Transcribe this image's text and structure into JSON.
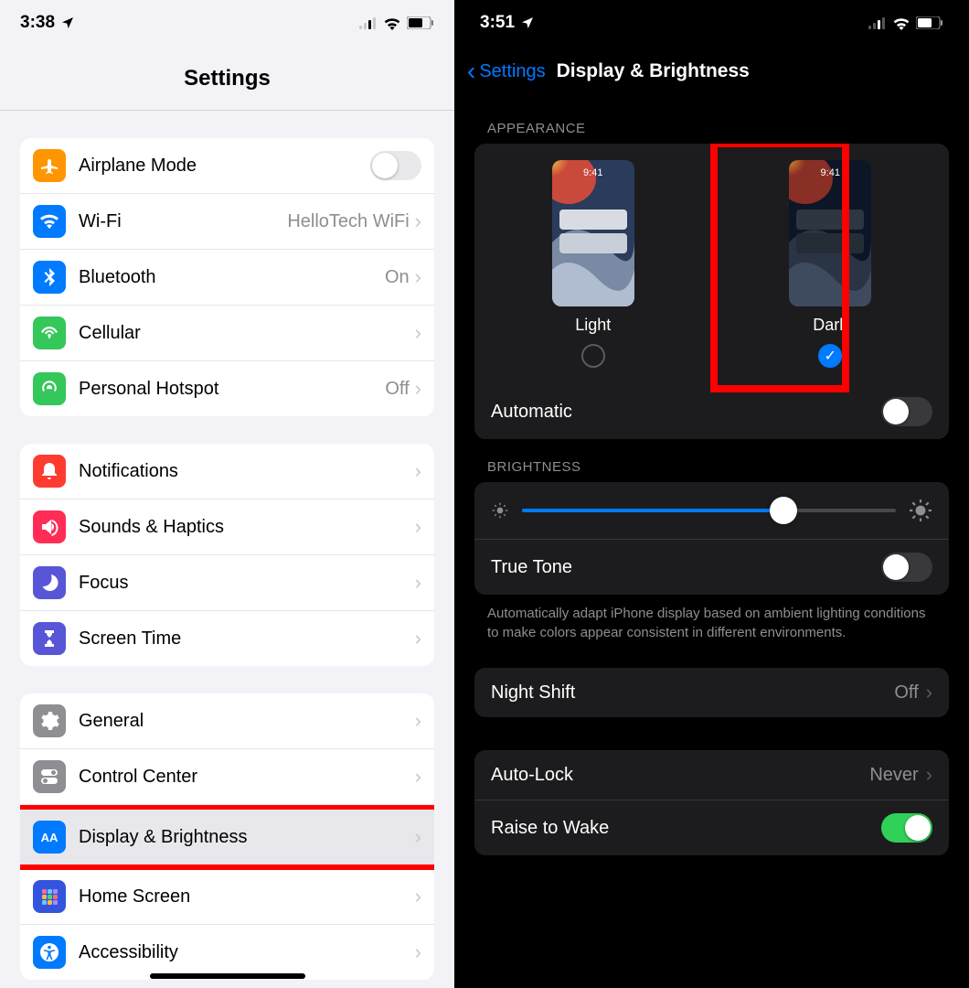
{
  "left": {
    "time": "3:38",
    "title": "Settings",
    "groups": [
      [
        {
          "icon": "airplane",
          "color": "#ff9500",
          "label": "Airplane Mode",
          "switch": false
        },
        {
          "icon": "wifi",
          "color": "#007aff",
          "label": "Wi-Fi",
          "value": "HelloTech WiFi",
          "chevron": true
        },
        {
          "icon": "bluetooth",
          "color": "#007aff",
          "label": "Bluetooth",
          "value": "On",
          "chevron": true
        },
        {
          "icon": "cellular",
          "color": "#34c759",
          "label": "Cellular",
          "chevron": true
        },
        {
          "icon": "hotspot",
          "color": "#34c759",
          "label": "Personal Hotspot",
          "value": "Off",
          "chevron": true
        }
      ],
      [
        {
          "icon": "notifications",
          "color": "#ff3b30",
          "label": "Notifications",
          "chevron": true
        },
        {
          "icon": "sounds",
          "color": "#ff2d55",
          "label": "Sounds & Haptics",
          "chevron": true
        },
        {
          "icon": "focus",
          "color": "#5856d6",
          "label": "Focus",
          "chevron": true
        },
        {
          "icon": "screentime",
          "color": "#5856d6",
          "label": "Screen Time",
          "chevron": true
        }
      ],
      [
        {
          "icon": "general",
          "color": "#8e8e93",
          "label": "General",
          "chevron": true
        },
        {
          "icon": "controlcenter",
          "color": "#8e8e93",
          "label": "Control Center",
          "chevron": true
        },
        {
          "icon": "display",
          "color": "#007aff",
          "label": "Display & Brightness",
          "chevron": true,
          "highlight": true
        },
        {
          "icon": "homescreen",
          "color": "#3355dd",
          "label": "Home Screen",
          "chevron": true
        },
        {
          "icon": "accessibility",
          "color": "#007aff",
          "label": "Accessibility",
          "chevron": true
        }
      ]
    ]
  },
  "right": {
    "time": "3:51",
    "back": "Settings",
    "title": "Display & Brightness",
    "appearance_label": "APPEARANCE",
    "appearance": {
      "light_label": "Light",
      "dark_label": "Dark",
      "selected": "dark",
      "preview_time": "9:41"
    },
    "automatic_label": "Automatic",
    "automatic_on": false,
    "brightness_label": "BRIGHTNESS",
    "brightness_pct": 70,
    "truetone_label": "True Tone",
    "truetone_on": false,
    "truetone_footer": "Automatically adapt iPhone display based on ambient lighting conditions to make colors appear consistent in different environments.",
    "nightshift_label": "Night Shift",
    "nightshift_value": "Off",
    "autolock_label": "Auto-Lock",
    "autolock_value": "Never",
    "raisewake_label": "Raise to Wake",
    "raisewake_on": true
  }
}
